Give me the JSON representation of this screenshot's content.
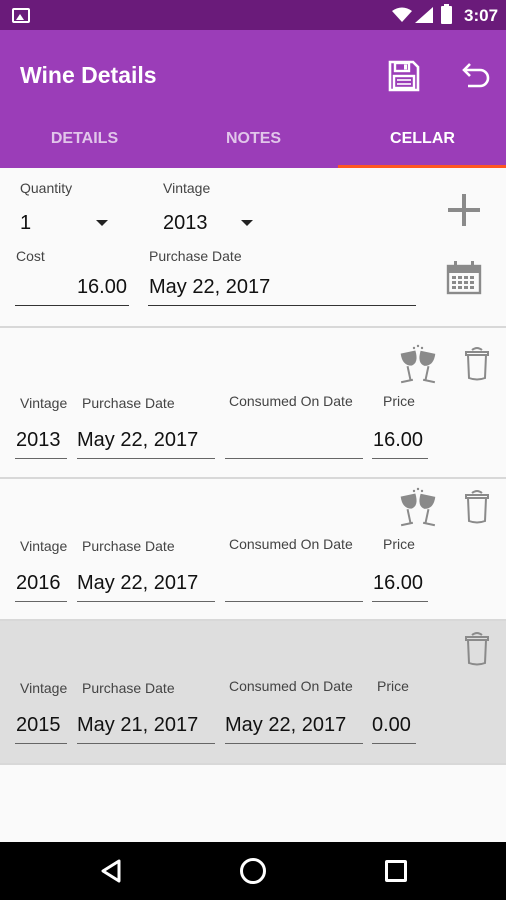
{
  "status_bar": {
    "time": "3:07",
    "icons": [
      "image-icon",
      "wifi-icon",
      "signal-icon",
      "battery-icon"
    ]
  },
  "app_bar": {
    "title": "Wine Details",
    "actions": [
      "save-icon",
      "undo-icon"
    ],
    "color": "#9b3db8"
  },
  "tabs": [
    {
      "label": "DETAILS"
    },
    {
      "label": "NOTES"
    },
    {
      "label": "CELLAR",
      "active": true
    }
  ],
  "form": {
    "quantity_label": "Quantity",
    "quantity_value": "1",
    "vintage_label": "Vintage",
    "vintage_value": "2013",
    "cost_label": "Cost",
    "cost_value": "16.00",
    "purchase_date_label": "Purchase Date",
    "purchase_date_value": "May 22, 2017"
  },
  "columns": {
    "vintage": "Vintage",
    "purchase_date": "Purchase Date",
    "consumed_on": "Consumed On Date",
    "price": "Price"
  },
  "entries": [
    {
      "vintage": "2013",
      "purchase_date": "May 22, 2017",
      "consumed_on": "",
      "price": "16.00",
      "consumed": false
    },
    {
      "vintage": "2016",
      "purchase_date": "May 22, 2017",
      "consumed_on": "",
      "price": "16.00",
      "consumed": false
    },
    {
      "vintage": "2015",
      "purchase_date": "May 21, 2017",
      "consumed_on": "May 22, 2017",
      "price": "0.00",
      "consumed": true
    }
  ],
  "nav": [
    "back-icon",
    "home-icon",
    "recents-icon"
  ]
}
